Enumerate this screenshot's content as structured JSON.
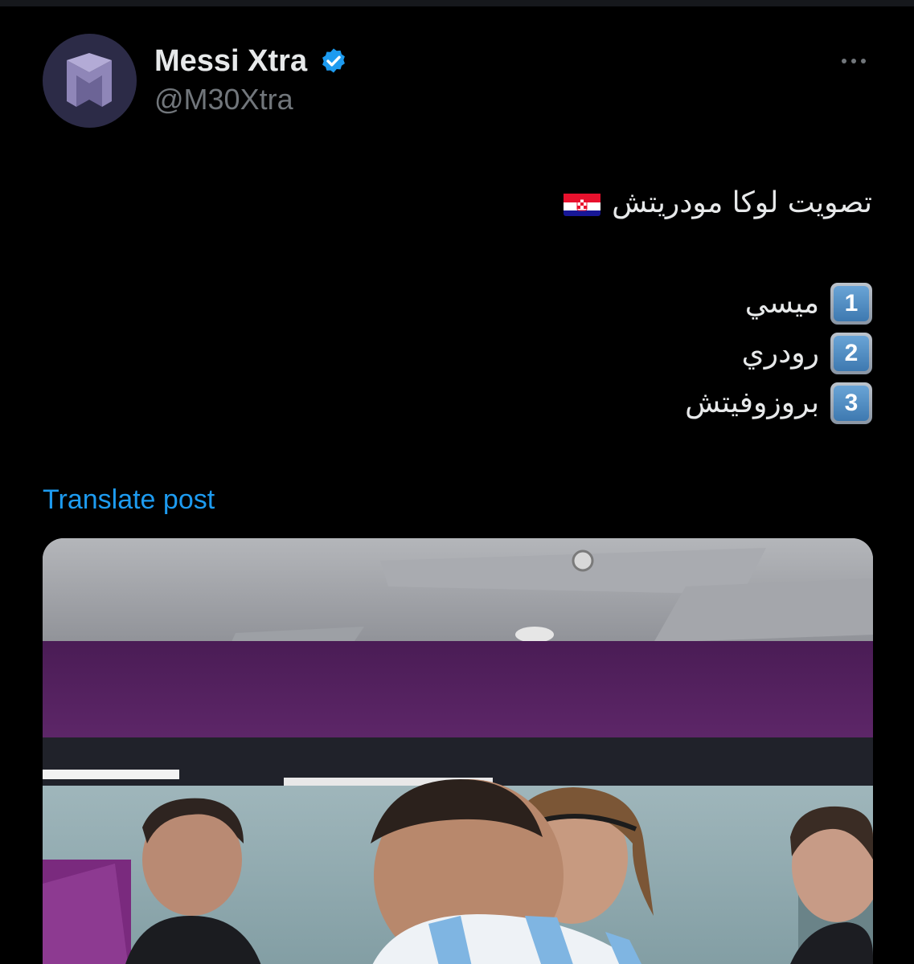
{
  "author": {
    "display_name": "Messi Xtra",
    "handle": "@M30Xtra",
    "verified": true,
    "avatar_icon": "m-logo-icon"
  },
  "post": {
    "title_line": "تصويت لوكا مودريتش",
    "title_flag": "croatia-flag-icon",
    "options": [
      {
        "number": "1",
        "text": "ميسي"
      },
      {
        "number": "2",
        "text": "رودري"
      },
      {
        "number": "3",
        "text": "بروزوفيتش"
      }
    ],
    "translate_label": "Translate post"
  },
  "more_icon": "more-horizontal-icon",
  "colors": {
    "background": "#000000",
    "text_primary": "#e7e9ea",
    "text_secondary": "#71767b",
    "link": "#1d9bf0",
    "verified_badge": "#1d9bf0"
  }
}
